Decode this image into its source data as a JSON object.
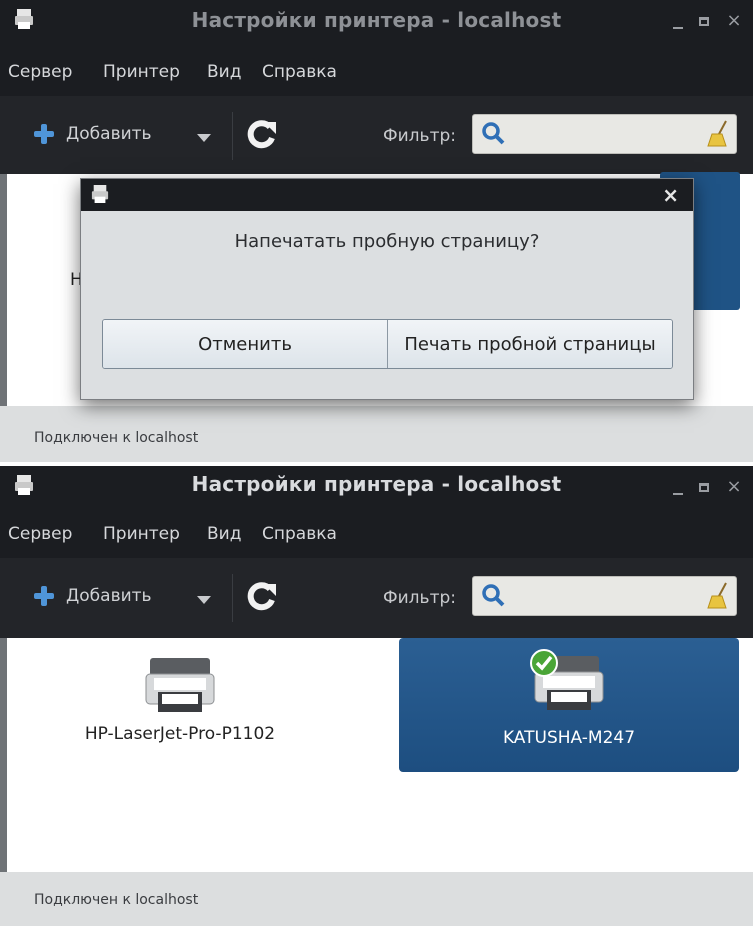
{
  "window": {
    "title": "Настройки принтера - localhost",
    "menu": [
      "Сервер",
      "Принтер",
      "Вид",
      "Справка"
    ],
    "toolbar": {
      "add_label": "Добавить",
      "filter_label": "Фильтр:",
      "filter_value": ""
    },
    "status": "Подключен к localhost"
  },
  "dialog": {
    "question": "Напечатать пробную страницу?",
    "cancel_label": "Отменить",
    "print_label": "Печать пробной страницы",
    "close_glyph": "×"
  },
  "background_fragment": "Н",
  "printers": [
    {
      "name": "HP-LaserJet-Pro-P1102",
      "selected": false,
      "default": false
    },
    {
      "name": "KATUSHA-M247",
      "selected": true,
      "default": true
    }
  ],
  "titlebar_glyphs": {
    "close": "×"
  },
  "colors": {
    "selection": "#1f5385",
    "accent_blue": "#4f95d8",
    "titlebar_bg": "#1b1d21"
  }
}
